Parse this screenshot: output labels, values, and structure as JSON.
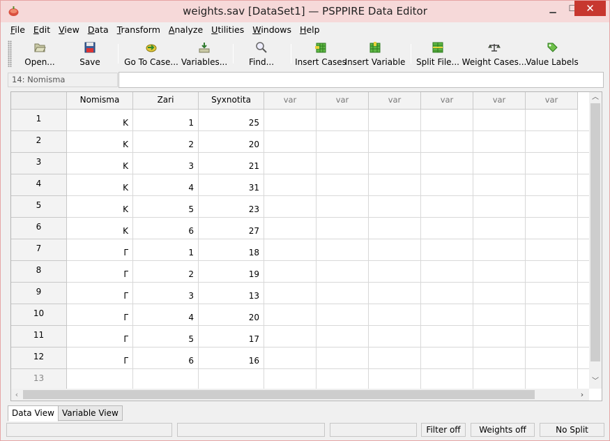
{
  "window": {
    "title": "weights.sav [DataSet1] — PSPPIRE Data Editor"
  },
  "menu": [
    {
      "label": "File",
      "u": "F",
      "rest": "ile"
    },
    {
      "label": "Edit",
      "u": "E",
      "rest": "dit"
    },
    {
      "label": "View",
      "u": "V",
      "rest": "iew"
    },
    {
      "label": "Data",
      "u": "D",
      "rest": "ata"
    },
    {
      "label": "Transform",
      "u": "T",
      "rest": "ransform"
    },
    {
      "label": "Analyze",
      "u": "A",
      "rest": "nalyze"
    },
    {
      "label": "Utilities",
      "u": "U",
      "rest": "tilities"
    },
    {
      "label": "Windows",
      "u": "W",
      "rest": "indows"
    },
    {
      "label": "Help",
      "u": "H",
      "rest": "elp"
    }
  ],
  "toolbar": {
    "open": "Open...",
    "save": "Save",
    "goto_case": "Go To Case...",
    "variables": "Variables...",
    "find": "Find...",
    "insert_cases": "Insert Cases",
    "insert_variable": "Insert Variable",
    "split_file": "Split File...",
    "weight_cases": "Weight Cases...",
    "value_labels": "Value Labels"
  },
  "cell_ref": "14: Nomisma",
  "entry_value": "",
  "columns": [
    "Nomisma",
    "Zari",
    "Syxnotita",
    "var",
    "var",
    "var",
    "var",
    "var",
    "var"
  ],
  "rows": [
    {
      "n": "1",
      "nomisma": "K",
      "zari": "1",
      "syxnotita": "25"
    },
    {
      "n": "2",
      "nomisma": "K",
      "zari": "2",
      "syxnotita": "20"
    },
    {
      "n": "3",
      "nomisma": "K",
      "zari": "3",
      "syxnotita": "21"
    },
    {
      "n": "4",
      "nomisma": "K",
      "zari": "4",
      "syxnotita": "31"
    },
    {
      "n": "5",
      "nomisma": "K",
      "zari": "5",
      "syxnotita": "23"
    },
    {
      "n": "6",
      "nomisma": "K",
      "zari": "6",
      "syxnotita": "27"
    },
    {
      "n": "7",
      "nomisma": "Γ",
      "zari": "1",
      "syxnotita": "18"
    },
    {
      "n": "8",
      "nomisma": "Γ",
      "zari": "2",
      "syxnotita": "19"
    },
    {
      "n": "9",
      "nomisma": "Γ",
      "zari": "3",
      "syxnotita": "13"
    },
    {
      "n": "10",
      "nomisma": "Γ",
      "zari": "4",
      "syxnotita": "20"
    },
    {
      "n": "11",
      "nomisma": "Γ",
      "zari": "5",
      "syxnotita": "17"
    },
    {
      "n": "12",
      "nomisma": "Γ",
      "zari": "6",
      "syxnotita": "16"
    },
    {
      "n": "13",
      "nomisma": "",
      "zari": "",
      "syxnotita": ""
    }
  ],
  "tabs": {
    "data_view": "Data View",
    "variable_view": "Variable View"
  },
  "status": {
    "filter": "Filter off",
    "weights": "Weights off",
    "split": "No Split"
  },
  "colors": {
    "titlebar": "#f6d9d9",
    "close_button": "#c7372f"
  }
}
